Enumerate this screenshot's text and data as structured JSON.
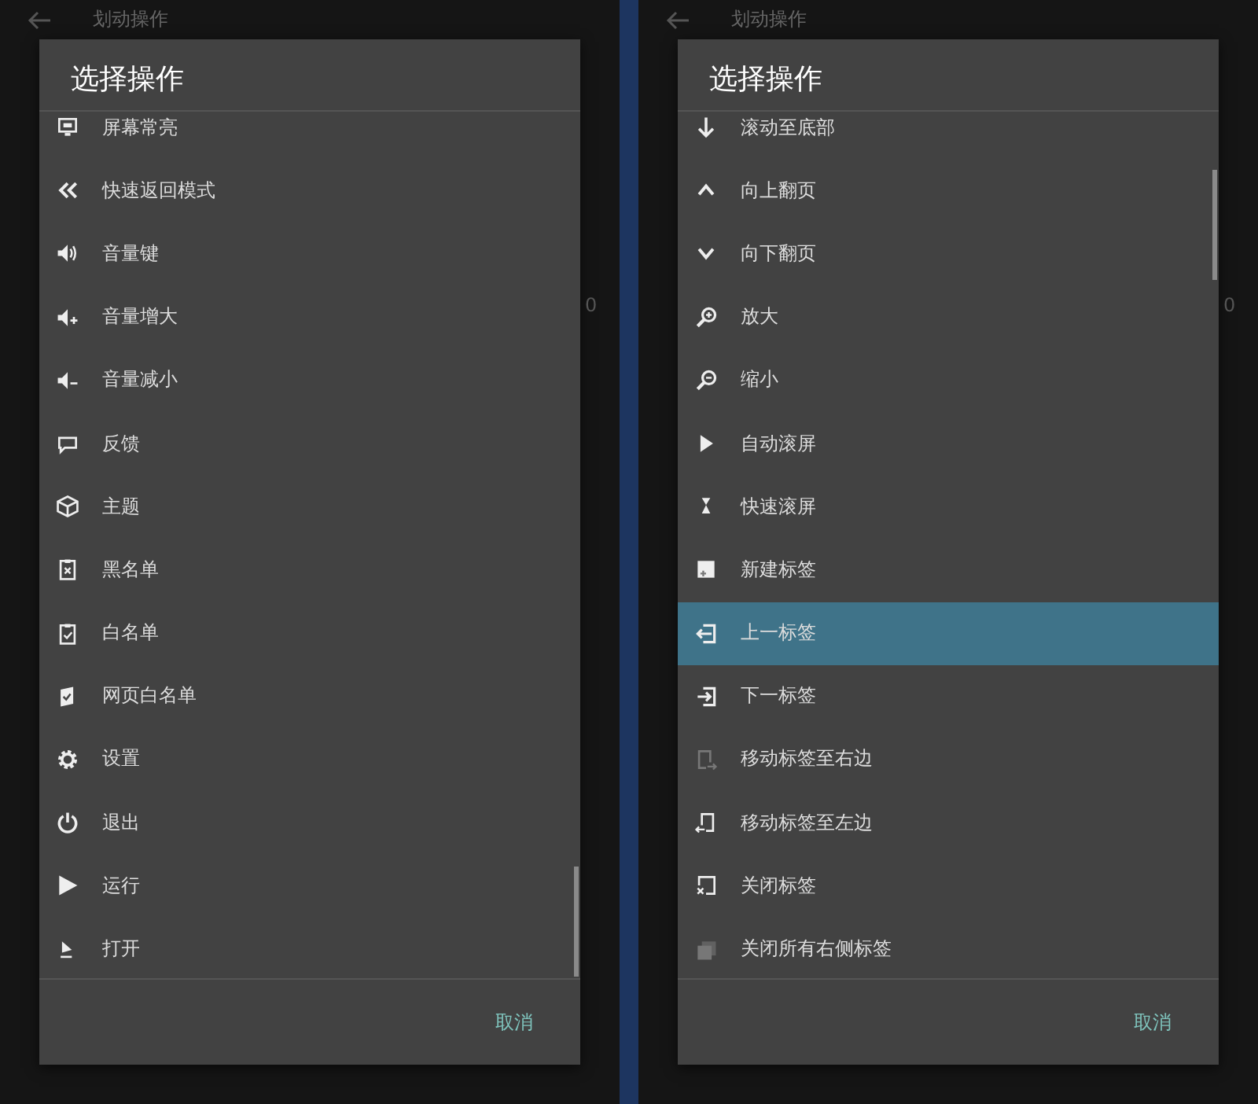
{
  "screens": [
    {
      "app_bar": {
        "title": "划动操作",
        "value_fragment": "0"
      },
      "dialog": {
        "title": "选择操作",
        "items": [
          {
            "label": "屏幕常亮",
            "selected": false,
            "icon_dimmed": false
          },
          {
            "label": "快速返回模式",
            "selected": false,
            "icon_dimmed": false
          },
          {
            "label": "音量键",
            "selected": false,
            "icon_dimmed": false
          },
          {
            "label": "音量增大",
            "selected": false,
            "icon_dimmed": false
          },
          {
            "label": "音量减小",
            "selected": false,
            "icon_dimmed": false
          },
          {
            "label": "反馈",
            "selected": false,
            "icon_dimmed": false
          },
          {
            "label": "主题",
            "selected": false,
            "icon_dimmed": false
          },
          {
            "label": "黑名单",
            "selected": false,
            "icon_dimmed": false
          },
          {
            "label": "白名单",
            "selected": false,
            "icon_dimmed": false
          },
          {
            "label": "网页白名单",
            "selected": false,
            "icon_dimmed": false
          },
          {
            "label": "设置",
            "selected": false,
            "icon_dimmed": false
          },
          {
            "label": "退出",
            "selected": false,
            "icon_dimmed": false
          },
          {
            "label": "运行",
            "selected": false,
            "icon_dimmed": false
          },
          {
            "label": "打开",
            "selected": false,
            "icon_dimmed": false
          }
        ],
        "cancel": "取消"
      }
    },
    {
      "app_bar": {
        "title": "划动操作",
        "value_fragment": "0"
      },
      "dialog": {
        "title": "选择操作",
        "items": [
          {
            "label": "滚动至底部",
            "selected": false,
            "icon_dimmed": false
          },
          {
            "label": "向上翻页",
            "selected": false,
            "icon_dimmed": false
          },
          {
            "label": "向下翻页",
            "selected": false,
            "icon_dimmed": false
          },
          {
            "label": "放大",
            "selected": false,
            "icon_dimmed": false
          },
          {
            "label": "缩小",
            "selected": false,
            "icon_dimmed": false
          },
          {
            "label": "自动滚屏",
            "selected": false,
            "icon_dimmed": false
          },
          {
            "label": "快速滚屏",
            "selected": false,
            "icon_dimmed": false
          },
          {
            "label": "新建标签",
            "selected": false,
            "icon_dimmed": false
          },
          {
            "label": "上一标签",
            "selected": true,
            "icon_dimmed": false
          },
          {
            "label": "下一标签",
            "selected": false,
            "icon_dimmed": false
          },
          {
            "label": "移动标签至右边",
            "selected": false,
            "icon_dimmed": true
          },
          {
            "label": "移动标签至左边",
            "selected": false,
            "icon_dimmed": false
          },
          {
            "label": "关闭标签",
            "selected": false,
            "icon_dimmed": false
          },
          {
            "label": "关闭所有右侧标签",
            "selected": false,
            "icon_dimmed": true
          }
        ],
        "cancel": "取消"
      }
    }
  ]
}
